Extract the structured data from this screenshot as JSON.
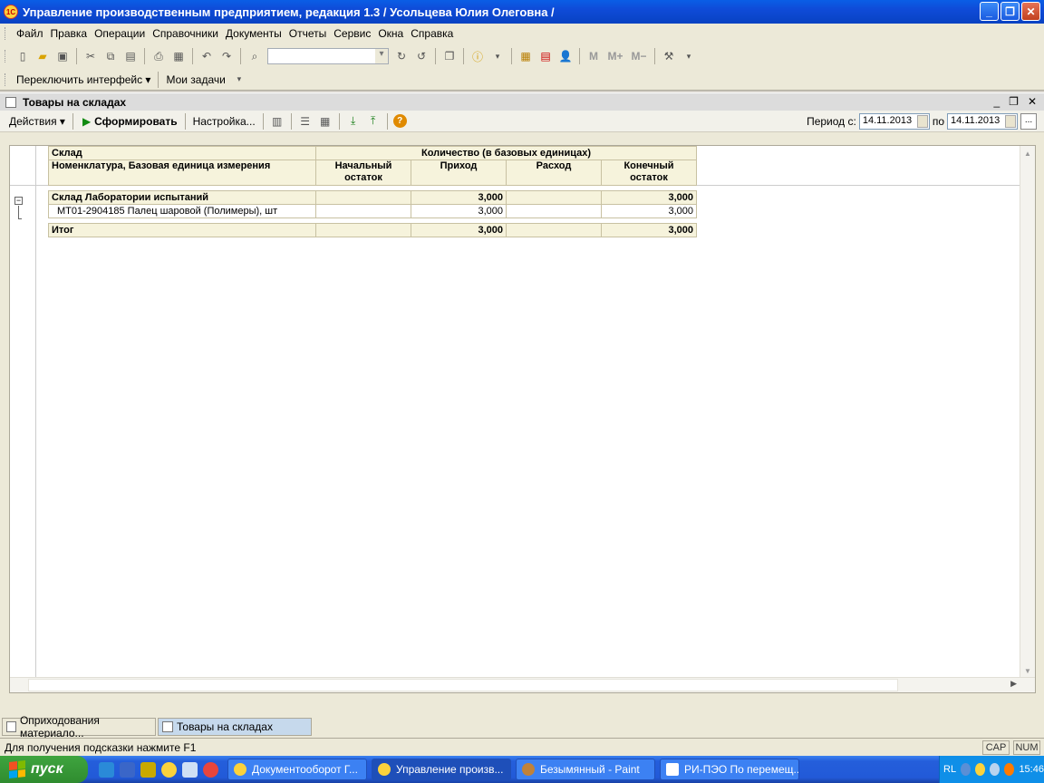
{
  "window": {
    "title": "Управление производственным предприятием, редакция 1.3 / Усольцева Юлия Олеговна /",
    "icon": "1С"
  },
  "menu": [
    "Файл",
    "Правка",
    "Операции",
    "Справочники",
    "Документы",
    "Отчеты",
    "Сервис",
    "Окна",
    "Справка"
  ],
  "toolbar2": {
    "switch_interface": "Переключить интерфейс ▾",
    "my_tasks": "Мои задачи"
  },
  "child": {
    "title": "Товары на складах",
    "actions": "Действия ▾",
    "generate": "Сформировать",
    "settings": "Настройка...",
    "period_from_label": "Период с:",
    "period_from": "14.11.2013",
    "period_to_label": "по",
    "period_to": "14.11.2013",
    "dots": "..."
  },
  "report": {
    "header": {
      "col1_row1": "Склад",
      "col1_row2": "Номенклатура, Базовая единица измерения",
      "qty_group": "Количество (в базовых единицах)",
      "start": "Начальный остаток",
      "in": "Приход",
      "out": "Расход",
      "end": "Конечный остаток"
    },
    "group": {
      "name": "Склад Лаборатории испытаний",
      "start": "",
      "in": "3,000",
      "out": "",
      "end": "3,000"
    },
    "rows": [
      {
        "name": "МТ01-2904185 Палец шаровой (Полимеры), шт",
        "start": "",
        "in": "3,000",
        "out": "",
        "end": "3,000"
      }
    ],
    "total": {
      "name": "Итог",
      "start": "",
      "in": "3,000",
      "out": "",
      "end": "3,000"
    }
  },
  "window_tabs": [
    {
      "label": "Оприходования материало...",
      "active": false
    },
    {
      "label": "Товары на складах",
      "active": true
    }
  ],
  "status": {
    "hint": "Для получения подсказки нажмите F1",
    "cap": "CAP",
    "num": "NUM"
  },
  "taskbar": {
    "start": "пуск",
    "tasks": [
      "Документооборот Г...",
      "Управление произв...",
      "Безымянный - Paint",
      "РИ-ПЭО По перемещ..."
    ],
    "lang": "RL",
    "clock": "15:46"
  }
}
